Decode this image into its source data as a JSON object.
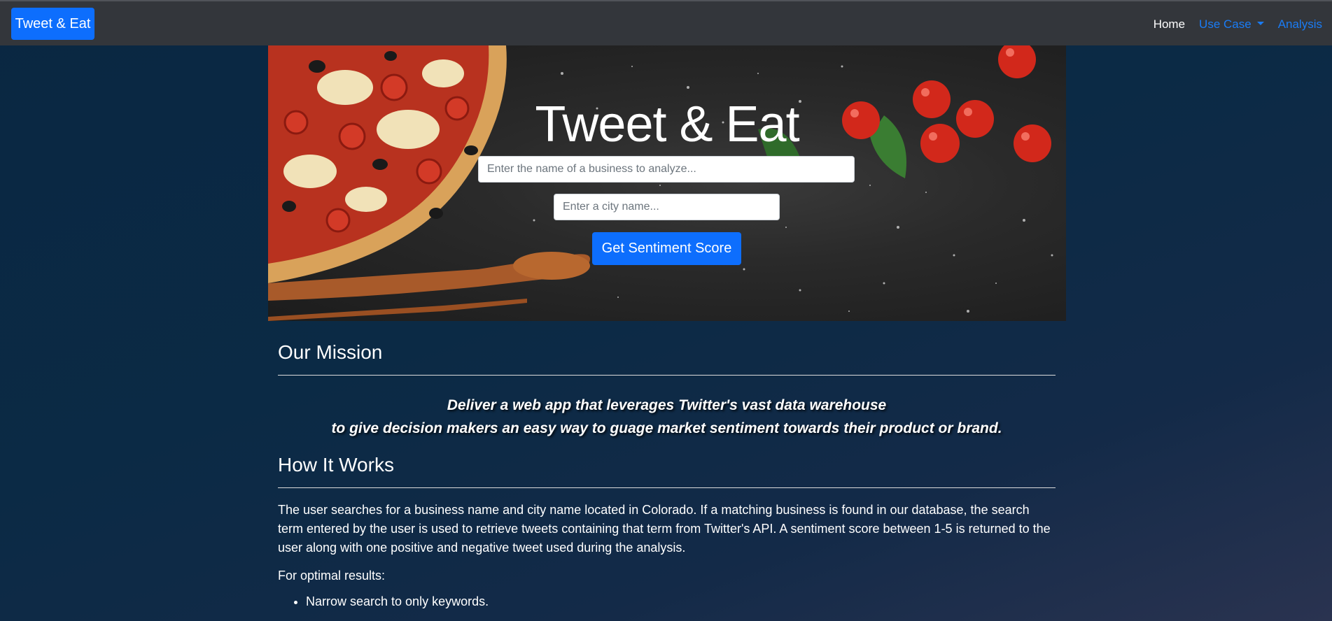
{
  "navbar": {
    "brand": "Tweet & Eat",
    "home": "Home",
    "use_case": "Use Case",
    "analysis": "Analysis"
  },
  "hero": {
    "title": "Tweet & Eat",
    "business_placeholder": "Enter the name of a business to analyze...",
    "city_placeholder": "Enter a city name...",
    "button": "Get Sentiment Score"
  },
  "mission": {
    "title": "Our Mission",
    "line1": "Deliver a web app that leverages Twitter's vast data warehouse",
    "line2": "to give decision makers an easy way to guage market sentiment towards their product or brand."
  },
  "how": {
    "title": "How It Works",
    "paragraph": "The user searches for a business name and city name located in Colorado. If a matching business is found in our database, the search term entered by the user is used to retrieve tweets containing that term from Twitter's API. A sentiment score between 1-5 is returned to the user along with one positive and negative tweet used during the analysis.",
    "optimal": "For optimal results:",
    "tips": [
      "Narrow search to only keywords."
    ]
  },
  "colors": {
    "accent": "#0d6efd",
    "navbar_bg": "#33363b",
    "link": "#1a7cf5"
  }
}
